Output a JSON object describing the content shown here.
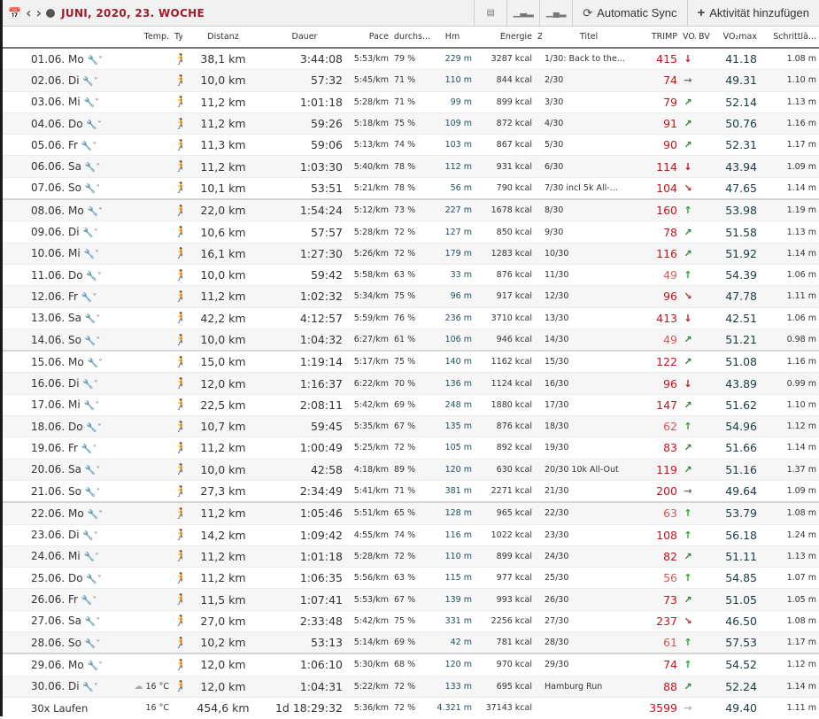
{
  "toolbar": {
    "title": "JUNI, 2020, 23. WOCHE",
    "calendar_icon": "calendar-icon",
    "prev_icon": "‹",
    "next_icon": "›",
    "sync_label": "Automatic Sync",
    "add_label": "Aktivität hinzufügen"
  },
  "columns": [
    "",
    "Temp.",
    "Ty",
    "Distanz",
    "Dauer",
    "Pace",
    "durchs...",
    "Hm",
    "Energie",
    "Z",
    "Titel",
    "TRIMP",
    "VO...",
    "BV",
    "VO₂max",
    "Schrittlä..."
  ],
  "rows": [
    {
      "date": "01.06. Mo",
      "temp": "",
      "dist": "38,1 km",
      "dur": "3:44:08",
      "pace": "5:53/km",
      "hr": "79 %",
      "hm": "229 m",
      "kcal": "3287 kcal",
      "title": "1/30: Back to the...",
      "trimp": "415",
      "trend": "down",
      "vo2": "41.18",
      "step": "1.08 m"
    },
    {
      "date": "02.06. Di",
      "temp": "",
      "dist": "10,0 km",
      "dur": "57:32",
      "pace": "5:45/km",
      "hr": "71 %",
      "hm": "110 m",
      "kcal": "844 kcal",
      "title": "2/30",
      "trimp": "74",
      "trend": "right",
      "vo2": "49.31",
      "step": "1.10 m"
    },
    {
      "date": "03.06. Mi",
      "temp": "",
      "dist": "11,2 km",
      "dur": "1:01:18",
      "pace": "5:28/km",
      "hr": "71 %",
      "hm": "99 m",
      "kcal": "899 kcal",
      "title": "3/30",
      "trimp": "79",
      "trend": "ne",
      "vo2": "52.14",
      "step": "1.13 m"
    },
    {
      "date": "04.06. Do",
      "temp": "",
      "dist": "11,2 km",
      "dur": "59:26",
      "pace": "5:18/km",
      "hr": "75 %",
      "hm": "109 m",
      "kcal": "872 kcal",
      "title": "4/30",
      "trimp": "91",
      "trend": "ne",
      "vo2": "50.76",
      "step": "1.16 m"
    },
    {
      "date": "05.06. Fr",
      "temp": "",
      "dist": "11,3 km",
      "dur": "59:06",
      "pace": "5:13/km",
      "hr": "74 %",
      "hm": "103 m",
      "kcal": "867 kcal",
      "title": "5/30",
      "trimp": "90",
      "trend": "ne",
      "vo2": "52.31",
      "step": "1.17 m"
    },
    {
      "date": "06.06. Sa",
      "temp": "",
      "dist": "11,2 km",
      "dur": "1:03:30",
      "pace": "5:40/km",
      "hr": "78 %",
      "hm": "112 m",
      "kcal": "931 kcal",
      "title": "6/30",
      "trimp": "114",
      "trend": "down",
      "vo2": "43.94",
      "step": "1.09 m"
    },
    {
      "date": "07.06. So",
      "temp": "",
      "dist": "10,1 km",
      "dur": "53:51",
      "pace": "5:21/km",
      "hr": "78 %",
      "hm": "56 m",
      "kcal": "790 kcal",
      "title": "7/30 incl 5k All-...",
      "trimp": "104",
      "trend": "se",
      "vo2": "47.65",
      "step": "1.14 m"
    },
    {
      "date": "08.06. Mo",
      "temp": "",
      "dist": "22,0 km",
      "dur": "1:54:24",
      "pace": "5:12/km",
      "hr": "73 %",
      "hm": "227 m",
      "kcal": "1678 kcal",
      "title": "8/30",
      "trimp": "160",
      "trend": "up",
      "vo2": "53.98",
      "step": "1.19 m"
    },
    {
      "date": "09.06. Di",
      "temp": "",
      "dist": "10,6 km",
      "dur": "57:57",
      "pace": "5:28/km",
      "hr": "72 %",
      "hm": "127 m",
      "kcal": "850 kcal",
      "title": "9/30",
      "trimp": "78",
      "trend": "ne",
      "vo2": "51.58",
      "step": "1.13 m"
    },
    {
      "date": "10.06. Mi",
      "temp": "",
      "dist": "16,1 km",
      "dur": "1:27:30",
      "pace": "5:26/km",
      "hr": "72 %",
      "hm": "179 m",
      "kcal": "1283 kcal",
      "title": "10/30",
      "trimp": "116",
      "trend": "ne",
      "vo2": "51.92",
      "step": "1.14 m"
    },
    {
      "date": "11.06. Do",
      "temp": "",
      "dist": "10,0 km",
      "dur": "59:42",
      "pace": "5:58/km",
      "hr": "63 %",
      "hm": "33 m",
      "kcal": "876 kcal",
      "title": "11/30",
      "trimp": "49",
      "trend": "up",
      "vo2": "54.39",
      "step": "1.06 m"
    },
    {
      "date": "12.06. Fr",
      "temp": "",
      "dist": "11,2 km",
      "dur": "1:02:32",
      "pace": "5:34/km",
      "hr": "75 %",
      "hm": "96 m",
      "kcal": "917 kcal",
      "title": "12/30",
      "trimp": "96",
      "trend": "se",
      "vo2": "47.78",
      "step": "1.11 m"
    },
    {
      "date": "13.06. Sa",
      "temp": "",
      "dist": "42,2 km",
      "dur": "4:12:57",
      "pace": "5:59/km",
      "hr": "76 %",
      "hm": "236 m",
      "kcal": "3710 kcal",
      "title": "13/30",
      "trimp": "413",
      "trend": "down",
      "vo2": "42.51",
      "step": "1.06 m"
    },
    {
      "date": "14.06. So",
      "temp": "",
      "dist": "10,0 km",
      "dur": "1:04:32",
      "pace": "6:27/km",
      "hr": "61 %",
      "hm": "106 m",
      "kcal": "946 kcal",
      "title": "14/30",
      "trimp": "49",
      "trend": "ne",
      "vo2": "51.21",
      "step": "0.98 m"
    },
    {
      "date": "15.06. Mo",
      "temp": "",
      "dist": "15,0 km",
      "dur": "1:19:14",
      "pace": "5:17/km",
      "hr": "75 %",
      "hm": "140 m",
      "kcal": "1162 kcal",
      "title": "15/30",
      "trimp": "122",
      "trend": "ne",
      "vo2": "51.08",
      "step": "1.16 m"
    },
    {
      "date": "16.06. Di",
      "temp": "",
      "dist": "12,0 km",
      "dur": "1:16:37",
      "pace": "6:22/km",
      "hr": "70 %",
      "hm": "136 m",
      "kcal": "1124 kcal",
      "title": "16/30",
      "trimp": "96",
      "trend": "down",
      "vo2": "43.89",
      "step": "0.99 m"
    },
    {
      "date": "17.06. Mi",
      "temp": "",
      "dist": "22,5 km",
      "dur": "2:08:11",
      "pace": "5:42/km",
      "hr": "69 %",
      "hm": "248 m",
      "kcal": "1880 kcal",
      "title": "17/30",
      "trimp": "147",
      "trend": "ne",
      "vo2": "51.62",
      "step": "1.10 m"
    },
    {
      "date": "18.06. Do",
      "temp": "",
      "dist": "10,7 km",
      "dur": "59:45",
      "pace": "5:35/km",
      "hr": "67 %",
      "hm": "135 m",
      "kcal": "876 kcal",
      "title": "18/30",
      "trimp": "62",
      "trend": "up",
      "vo2": "54.96",
      "step": "1.12 m"
    },
    {
      "date": "19.06. Fr",
      "temp": "",
      "dist": "11,2 km",
      "dur": "1:00:49",
      "pace": "5:25/km",
      "hr": "72 %",
      "hm": "105 m",
      "kcal": "892 kcal",
      "title": "19/30",
      "trimp": "83",
      "trend": "ne",
      "vo2": "51.66",
      "step": "1.14 m"
    },
    {
      "date": "20.06. Sa",
      "temp": "",
      "dist": "10,0 km",
      "dur": "42:58",
      "pace": "4:18/km",
      "hr": "89 %",
      "hm": "120 m",
      "kcal": "630 kcal",
      "title": "20/30 10k All-Out",
      "trimp": "119",
      "trend": "ne",
      "vo2": "51.16",
      "step": "1.37 m"
    },
    {
      "date": "21.06. So",
      "temp": "",
      "dist": "27,3 km",
      "dur": "2:34:49",
      "pace": "5:41/km",
      "hr": "71 %",
      "hm": "381 m",
      "kcal": "2271 kcal",
      "title": "21/30",
      "trimp": "200",
      "trend": "right",
      "vo2": "49.64",
      "step": "1.09 m"
    },
    {
      "date": "22.06. Mo",
      "temp": "",
      "dist": "11,2 km",
      "dur": "1:05:46",
      "pace": "5:51/km",
      "hr": "65 %",
      "hm": "128 m",
      "kcal": "965 kcal",
      "title": "22/30",
      "trimp": "63",
      "trend": "up",
      "vo2": "53.79",
      "step": "1.08 m"
    },
    {
      "date": "23.06. Di",
      "temp": "",
      "dist": "14,2 km",
      "dur": "1:09:42",
      "pace": "4:55/km",
      "hr": "74 %",
      "hm": "116 m",
      "kcal": "1022 kcal",
      "title": "23/30",
      "trimp": "108",
      "trend": "up",
      "vo2": "56.18",
      "step": "1.24 m"
    },
    {
      "date": "24.06. Mi",
      "temp": "",
      "dist": "11,2 km",
      "dur": "1:01:18",
      "pace": "5:28/km",
      "hr": "72 %",
      "hm": "110 m",
      "kcal": "899 kcal",
      "title": "24/30",
      "trimp": "82",
      "trend": "ne",
      "vo2": "51.11",
      "step": "1.13 m"
    },
    {
      "date": "25.06. Do",
      "temp": "",
      "dist": "11,2 km",
      "dur": "1:06:35",
      "pace": "5:56/km",
      "hr": "63 %",
      "hm": "115 m",
      "kcal": "977 kcal",
      "title": "25/30",
      "trimp": "56",
      "trend": "up",
      "vo2": "54.85",
      "step": "1.07 m"
    },
    {
      "date": "26.06. Fr",
      "temp": "",
      "dist": "11,5 km",
      "dur": "1:07:41",
      "pace": "5:53/km",
      "hr": "67 %",
      "hm": "139 m",
      "kcal": "993 kcal",
      "title": "26/30",
      "trimp": "73",
      "trend": "ne",
      "vo2": "51.05",
      "step": "1.05 m"
    },
    {
      "date": "27.06. Sa",
      "temp": "",
      "dist": "27,0 km",
      "dur": "2:33:48",
      "pace": "5:42/km",
      "hr": "75 %",
      "hm": "331 m",
      "kcal": "2256 kcal",
      "title": "27/30",
      "trimp": "237",
      "trend": "se",
      "vo2": "46.50",
      "step": "1.08 m"
    },
    {
      "date": "28.06. So",
      "temp": "",
      "dist": "10,2 km",
      "dur": "53:13",
      "pace": "5:14/km",
      "hr": "69 %",
      "hm": "42 m",
      "kcal": "781 kcal",
      "title": "28/30",
      "trimp": "61",
      "trend": "up",
      "vo2": "57.53",
      "step": "1.17 m"
    },
    {
      "date": "29.06. Mo",
      "temp": "",
      "dist": "12,0 km",
      "dur": "1:06:10",
      "pace": "5:30/km",
      "hr": "68 %",
      "hm": "120 m",
      "kcal": "970 kcal",
      "title": "29/30",
      "trimp": "74",
      "trend": "up",
      "vo2": "54.52",
      "step": "1.12 m"
    },
    {
      "date": "30.06. Di",
      "temp": "16 °C",
      "dist": "12,0 km",
      "dur": "1:04:31",
      "pace": "5:22/km",
      "hr": "72 %",
      "hm": "133 m",
      "kcal": "695 kcal",
      "title": "Hamburg Run",
      "trimp": "88",
      "trend": "ne",
      "vo2": "52.24",
      "step": "1.14 m"
    }
  ],
  "summary": {
    "label": "30x Laufen",
    "temp": "16 °C",
    "dist": "454,6 km",
    "dur": "1d 18:29:32",
    "pace": "5:36/km",
    "hr": "72 %",
    "hm": "4.321 m",
    "kcal": "37143 kcal",
    "trimp": "3599",
    "trend": "right",
    "vo2": "49.40",
    "step": "1.11 m"
  }
}
